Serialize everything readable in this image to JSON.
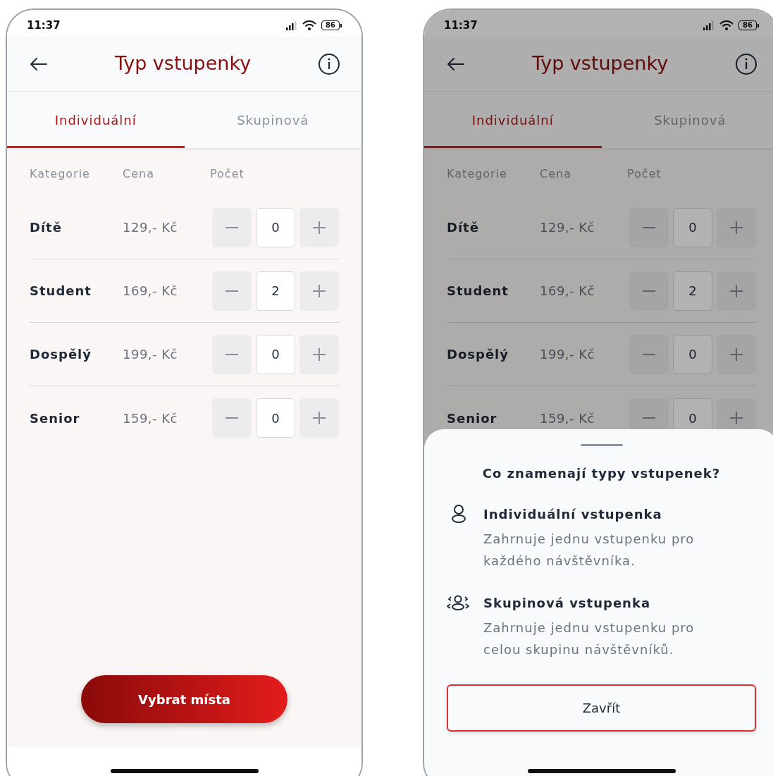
{
  "phones": [
    {
      "status_bar": {
        "time": "11:37",
        "battery": "86"
      },
      "header": {
        "title": "Typ vstupenky"
      },
      "tabs": [
        {
          "label": "Individuální",
          "selected": true
        },
        {
          "label": "Skupinová",
          "selected": false
        }
      ],
      "table": {
        "columns": [
          "Kategorie",
          "Cena",
          "Počet"
        ],
        "rows": [
          {
            "category": "Dítě",
            "price": "129,- Kč",
            "count": "0"
          },
          {
            "category": "Student",
            "price": "169,- Kč",
            "count": "2"
          },
          {
            "category": "Dospělý",
            "price": "199,- Kč",
            "count": "0"
          },
          {
            "category": "Senior",
            "price": "159,- Kč",
            "count": "0"
          }
        ]
      },
      "button": "Vybrat místa"
    },
    {
      "status_bar": {
        "time": "11:37",
        "battery": "86"
      },
      "header": {
        "title": "Typ vstupenky"
      },
      "tabs": [
        {
          "label": "Individuální",
          "selected": true
        },
        {
          "label": "Skupinová",
          "selected": false
        }
      ],
      "table": {
        "columns": [
          "Kategorie",
          "Cena",
          "Počet"
        ],
        "rows": [
          {
            "category": "Dítě",
            "price": "129,- Kč",
            "count": "0"
          },
          {
            "category": "Student",
            "price": "169,- Kč",
            "count": "2"
          },
          {
            "category": "Dospělý",
            "price": "199,- Kč",
            "count": "0"
          },
          {
            "category": "Senior",
            "price": "159,- Kč",
            "count": "0"
          }
        ]
      },
      "sheet": {
        "title": "Co znamenají typy vstupenek?",
        "items": [
          {
            "kind": "person",
            "title": "Individuální vstupenka",
            "text": "Zahrnuje jednu vstupenku pro každého návštěvníka."
          },
          {
            "kind": "group",
            "title": "Skupinová vstupenka",
            "text": "Zahrnuje jednu vstupenku pro celou skupinu návštěvníků."
          }
        ],
        "button": "Zavřít"
      }
    }
  ]
}
